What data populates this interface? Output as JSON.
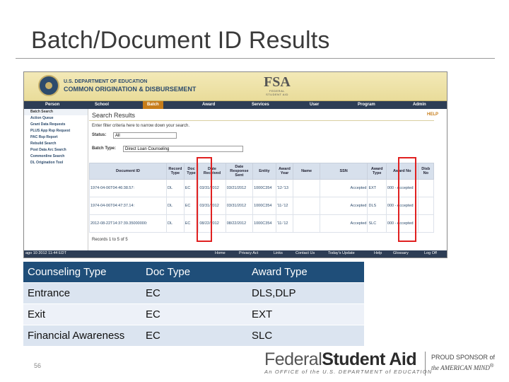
{
  "slide": {
    "title": "Batch/Document ID Results",
    "page_number": "56"
  },
  "screenshot": {
    "dept": "U.S. DEPARTMENT OF EDUCATION",
    "system": "COMMON ORIGINATION & DISBURSEMENT",
    "fsa_mark": "FSA",
    "fsa_sub": "FEDERAL STUDENT AID",
    "nav": [
      "Person",
      "School",
      "Batch",
      "Award",
      "Services",
      "User",
      "Program",
      "Admin"
    ],
    "nav_active": "Batch",
    "left_menu": [
      "Batch Search",
      "Action Queue",
      "Grant Data Requests",
      "PLUS App Rsp Request",
      "PAC Rsp Report",
      "Rebuild Search",
      "Post Data Arc Search",
      "Commonline Search",
      "DL Origination Tool"
    ],
    "page_heading": "Search Results",
    "help": "HELP",
    "hint": "Enter filter criteria here to narrow down your search.",
    "status_label": "Status:",
    "status_value": "All",
    "batch_type_label": "Batch Type:",
    "batch_type_value": "Direct Loan Counseling",
    "columns": [
      "Document ID",
      "Record Type",
      "Doc Type",
      "Date Received",
      "Date Response Sent",
      "Entity",
      "Award Year",
      "Name",
      "SSN",
      "Award Type",
      "Award No",
      "Disb No"
    ],
    "rows": [
      [
        "1974-04-06T04:46:38.57:",
        "DL",
        "EC",
        "03/31/2012",
        "03/21/2012",
        "1000C354",
        "'12-'13",
        "",
        "Accepted",
        "EXT",
        "000 - Accepted",
        ""
      ],
      [
        "1974-04-06T04:47:37.14:",
        "DL",
        "EC",
        "03/31/2012",
        "03/31/2012",
        "1000C354",
        "'11-'12",
        "",
        "Accepted",
        "DLS",
        "000 - Accepted",
        ""
      ],
      [
        "2012-08-22T14:37:39.35000000:",
        "DL",
        "EC",
        "08/22/2012",
        "08/22/2012",
        "1000C354",
        "'11-'12",
        "",
        "Accepted",
        "SLC",
        "000 - Accepted",
        ""
      ]
    ],
    "records": "Records 1 to 5 of 5",
    "footer_date": "ago 10 2012 11:44 EDT",
    "footer_links": [
      "Home",
      "Privacy Act",
      "Links",
      "Contact Us",
      "Today's Update",
      "Help",
      "Glossary",
      "Log Off"
    ]
  },
  "mapping_table": {
    "headers": [
      "Counseling Type",
      "Doc Type",
      "Award Type"
    ],
    "rows": [
      [
        "Entrance",
        "EC",
        "DLS,DLP"
      ],
      [
        "Exit",
        "EC",
        "EXT"
      ],
      [
        "Financial Awareness",
        "EC",
        "SLC"
      ]
    ],
    "colors": {
      "header_bg": "#1f4e79",
      "row_bg": "#dbe4f0"
    }
  },
  "branding": {
    "fsa_name_plain": "Federal",
    "fsa_name_bold": "Student Aid",
    "fsa_tagline": "An OFFICE of the U.S. DEPARTMENT of EDUCATION",
    "sponsor_line1": "PROUD SPONSOR of",
    "sponsor_line2": "the AMERICAN MIND",
    "sponsor_mark": "®"
  }
}
